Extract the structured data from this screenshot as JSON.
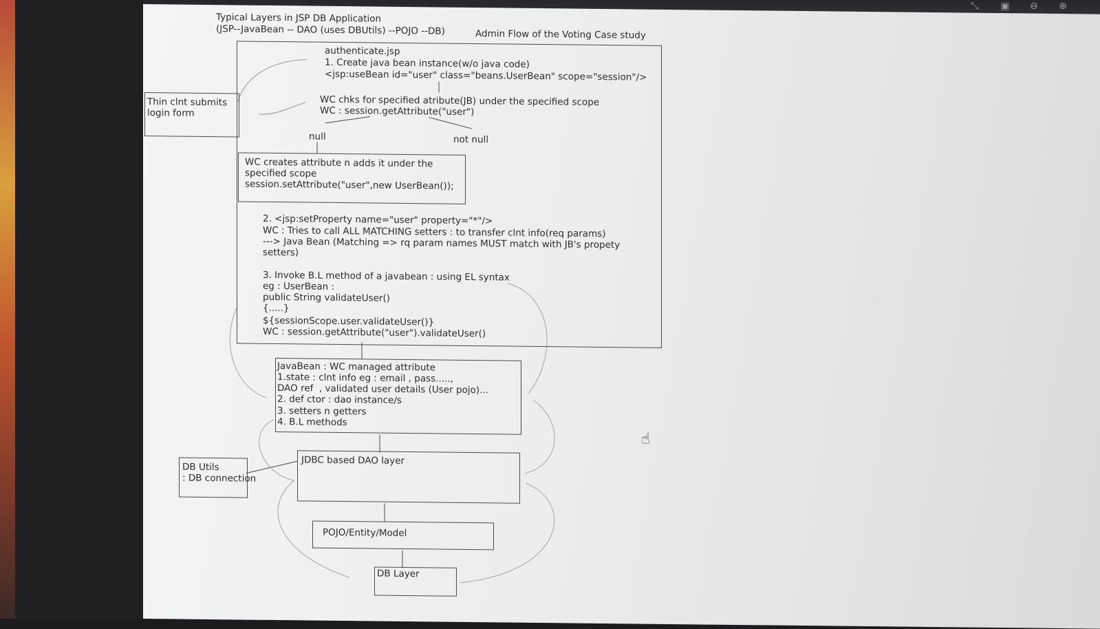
{
  "header": {
    "title": "Typical Layers in JSP DB Application",
    "subtitle": "(JSP--JavaBean -- DAO (uses DBUtils) --POJO --DB)",
    "admin_flow": "Admin Flow of the Voting Case study"
  },
  "client_box": {
    "line1": "Thin clnt submits",
    "line2": "login form"
  },
  "auth": {
    "file": "authenticate.jsp",
    "step1": "1. Create java bean instance(w/o java code)",
    "usebean": "<jsp:useBean id=\"user\" class=\"beans.UserBean\" scope=\"session\"/>",
    "wc_check": "WC chks for specified atribute(JB) under the specified scope",
    "wc_get": "WC : session.getAttribute(\"user\")",
    "null_label": "null",
    "not_null_label": "not null"
  },
  "create_box": {
    "line1": "WC creates attribute n adds it under the",
    "line2": "specified scope",
    "line3": "session.setAttribute(\"user\",new UserBean());"
  },
  "step2": {
    "line1": "2. <jsp:setProperty name=\"user\" property=\"*\"/>",
    "line2": "WC : Tries to call ALL MATCHING setters : to transfer clnt info(req params)",
    "line3": "---> Java Bean (Matching => rq param names MUST match with JB's propety",
    "line4": "setters)"
  },
  "step3": {
    "line1": "3. Invoke B.L method of a javabean : using EL syntax",
    "line2": "eg : UserBean :",
    "line3": "public String validateUser()",
    "line4": "{.....}",
    "line5": "${sessionScope.user.validateUser()}",
    "line6": "WC : session.getAttribute(\"user\").validateUser()"
  },
  "javabean_box": {
    "line1": "JavaBean : WC managed attribute",
    "line2": "1.state : clnt info eg : email , pass.....,",
    "line3": "DAO ref  , validated user details (User pojo)...",
    "line4": "2. def ctor : dao instance/s",
    "line5": "3. setters n getters",
    "line6": "4. B.L methods"
  },
  "dbutils_box": {
    "line1": "DB Utils",
    "line2": ": DB connection"
  },
  "dao_box": {
    "label": "JDBC based DAO layer"
  },
  "pojo_box": {
    "label": "POJO/Entity/Model"
  },
  "db_box": {
    "label": "DB Layer"
  },
  "toolbar_icons": [
    "collapse-icon",
    "screenshot-icon",
    "zoom-out-icon",
    "zoom-in-icon"
  ],
  "colors": {
    "ink": "#2c2c2c",
    "screen_bg": "#eceeee",
    "bezel": "#1c1c1e"
  }
}
